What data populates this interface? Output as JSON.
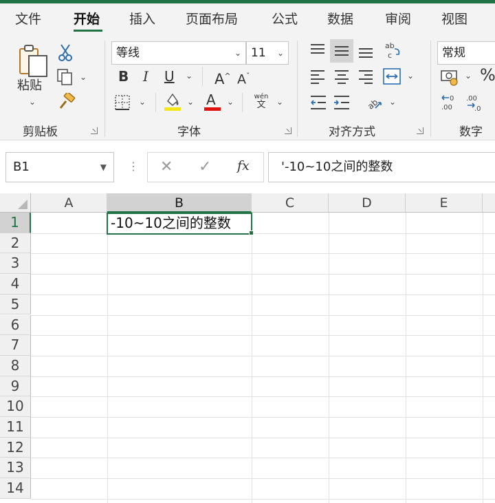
{
  "tabs": [
    "文件",
    "开始",
    "插入",
    "页面布局",
    "公式",
    "数据",
    "审阅",
    "视图"
  ],
  "ribbon": {
    "clipboard": {
      "paste_label": "粘贴",
      "group_label": "剪贴板"
    },
    "font": {
      "font_name": "等线",
      "font_size": "11",
      "bold": "B",
      "italic": "I",
      "underline": "U",
      "grow": "A",
      "shrink": "A",
      "font_color_letter": "A",
      "phonetic_top": "wén",
      "phonetic_bottom": "文",
      "group_label": "字体",
      "highlight_color": "#f5e61a",
      "font_color": "#e01010"
    },
    "alignment": {
      "group_label": "对齐方式"
    },
    "number": {
      "format": "常规",
      "percent": "%",
      "group_label": "数字"
    }
  },
  "formula_bar": {
    "name_box": "B1",
    "fx": "fx",
    "content": "'-10~10之间的整数"
  },
  "grid": {
    "columns": [
      "A",
      "B",
      "C",
      "D",
      "E"
    ],
    "rows": [
      "1",
      "2",
      "3",
      "4",
      "5",
      "6",
      "7",
      "8",
      "9",
      "10",
      "11",
      "12",
      "13",
      "14"
    ],
    "selected_cell": "B1",
    "b1_value": "-10~10之间的整数"
  },
  "colors": {
    "accent": "#217346"
  }
}
